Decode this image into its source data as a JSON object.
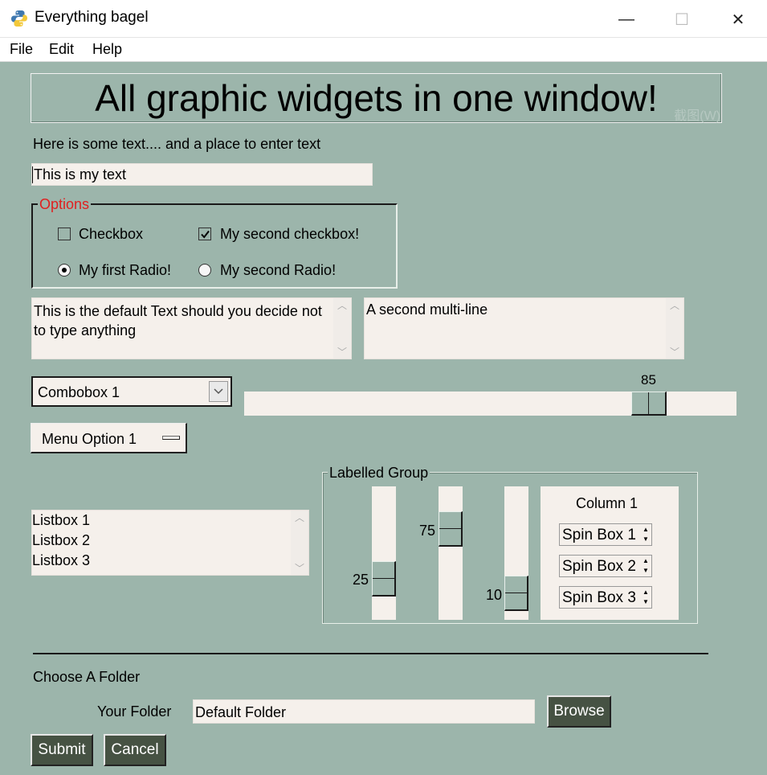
{
  "window": {
    "title": "Everything bagel",
    "controls": [
      "—",
      "☐",
      "✕"
    ]
  },
  "menubar": {
    "items": [
      "File",
      "Edit",
      "Help"
    ]
  },
  "header": {
    "banner": "All graphic widgets in one window!",
    "watermark": "截图(W)"
  },
  "intro": {
    "label": "Here is some text.... and a place to enter text",
    "input_value": "This is my text"
  },
  "options": {
    "legend": "Options",
    "legend_color": "#e02020",
    "checkbox1": {
      "label": "Checkbox",
      "checked": false
    },
    "checkbox2": {
      "label": "My second checkbox!",
      "checked": true
    },
    "radio1": {
      "label": "My first Radio!",
      "selected": true
    },
    "radio2": {
      "label": "My second Radio!",
      "selected": false
    }
  },
  "multiline": {
    "first": "This is the default Text should you decide not to type anything",
    "second": "A second multi-line"
  },
  "combo": {
    "value": "Combobox 1"
  },
  "hslider": {
    "value": "85"
  },
  "option_menu": {
    "value": "Menu Option 1"
  },
  "listbox": {
    "items": [
      "Listbox 1",
      "Listbox 2",
      "Listbox 3"
    ]
  },
  "labelled_group": {
    "legend": "Labelled Group",
    "sliders": [
      {
        "value": "25"
      },
      {
        "value": "75"
      },
      {
        "value": "10"
      }
    ],
    "column": {
      "header": "Column 1",
      "spinboxes": [
        "Spin Box 1",
        "Spin Box 2",
        "Spin Box 3"
      ]
    }
  },
  "folder": {
    "section_label": "Choose A Folder",
    "field_label": "Your Folder",
    "field_value": "Default Folder",
    "browse_label": "Browse"
  },
  "actions": {
    "submit_label": "Submit",
    "cancel_label": "Cancel"
  },
  "colors": {
    "background": "#9cb5ab",
    "input_bg": "#f5f0eb",
    "button_bg": "#465243"
  }
}
